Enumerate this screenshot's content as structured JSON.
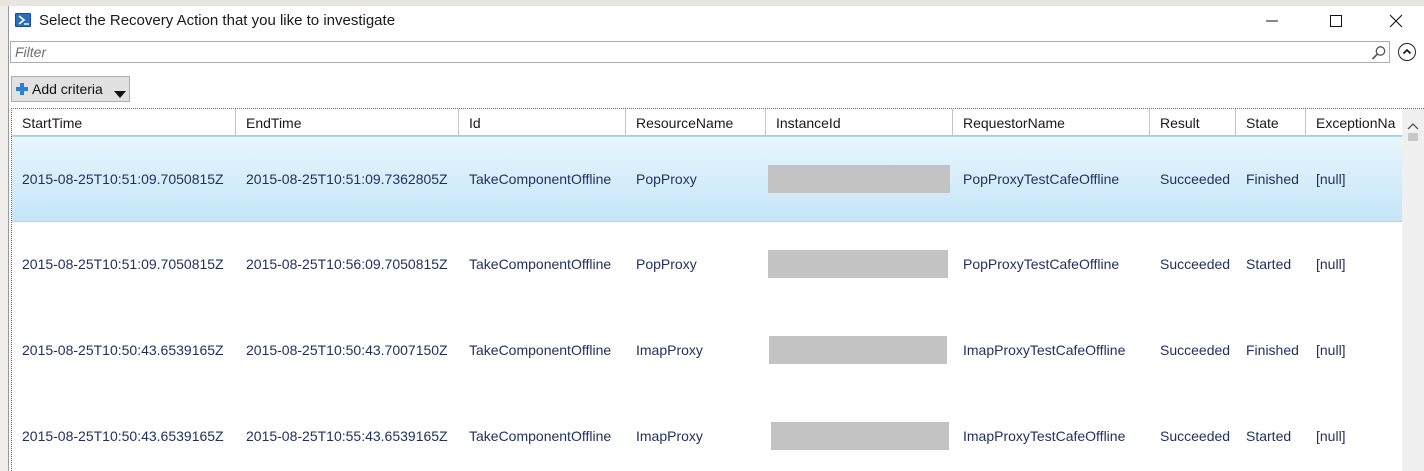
{
  "window": {
    "title": "Select the Recovery Action that you like to investigate",
    "icon": "powershell-icon"
  },
  "filter": {
    "placeholder": "Filter",
    "value": ""
  },
  "add_criteria": {
    "label": "Add criteria"
  },
  "grid": {
    "columns": [
      "StartTime",
      "EndTime",
      "Id",
      "ResourceName",
      "InstanceId",
      "RequestorName",
      "Result",
      "State",
      "ExceptionNa"
    ],
    "rows": [
      {
        "StartTime": "2015-08-25T10:51:09.7050815Z",
        "EndTime": "2015-08-25T10:51:09.7362805Z",
        "Id": "TakeComponentOffline",
        "ResourceName": "PopProxy",
        "RequestorName": "PopProxyTestCafeOffline",
        "Result": "Succeeded",
        "State": "Finished",
        "Exception": "[null]"
      },
      {
        "StartTime": "2015-08-25T10:51:09.7050815Z",
        "EndTime": "2015-08-25T10:56:09.7050815Z",
        "Id": "TakeComponentOffline",
        "ResourceName": "PopProxy",
        "RequestorName": "PopProxyTestCafeOffline",
        "Result": "Succeeded",
        "State": "Started",
        "Exception": "[null]"
      },
      {
        "StartTime": "2015-08-25T10:50:43.6539165Z",
        "EndTime": "2015-08-25T10:50:43.7007150Z",
        "Id": "TakeComponentOffline",
        "ResourceName": "ImapProxy",
        "RequestorName": "ImapProxyTestCafeOffline",
        "Result": "Succeeded",
        "State": "Finished",
        "Exception": "[null]"
      },
      {
        "StartTime": "2015-08-25T10:50:43.6539165Z",
        "EndTime": "2015-08-25T10:55:43.6539165Z",
        "Id": "TakeComponentOffline",
        "ResourceName": "ImapProxy",
        "RequestorName": "ImapProxyTestCafeOffline",
        "Result": "Succeeded",
        "State": "Started",
        "Exception": "[null]"
      }
    ]
  },
  "colors": {
    "selected_row": "#cde8f9",
    "cell_text": "#1f2f5e",
    "redaction": "#c3c3c3"
  }
}
